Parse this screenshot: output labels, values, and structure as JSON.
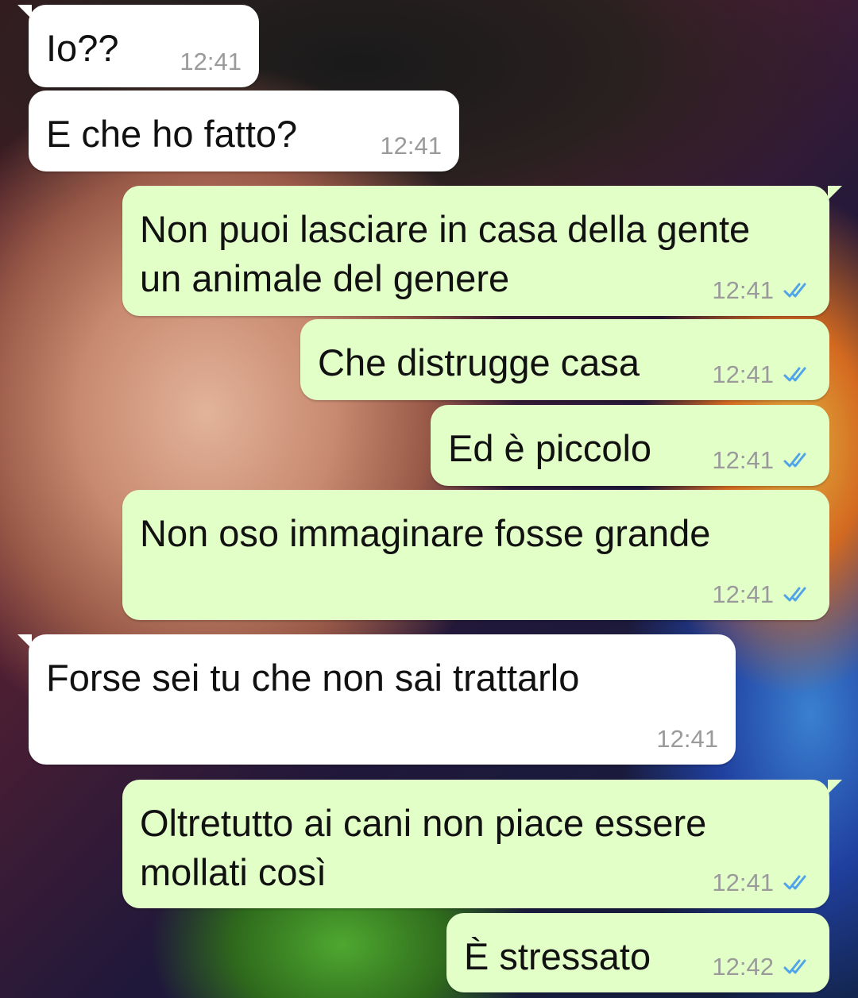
{
  "messages": [
    {
      "direction": "incoming",
      "text": "Io??",
      "time": "12:41"
    },
    {
      "direction": "incoming",
      "text": "E che ho fatto?",
      "time": "12:41"
    },
    {
      "direction": "outgoing",
      "text": "Non puoi lasciare in casa della gente\nun animale del genere",
      "time": "12:41",
      "status": "read-double-check-icon"
    },
    {
      "direction": "outgoing",
      "text": "Che distrugge casa",
      "time": "12:41",
      "status": "read-double-check-icon"
    },
    {
      "direction": "outgoing",
      "text": "Ed è piccolo",
      "time": "12:41",
      "status": "read-double-check-icon"
    },
    {
      "direction": "outgoing",
      "text": "Non oso immaginare fosse grande",
      "time": "12:41",
      "status": "read-double-check-icon"
    },
    {
      "direction": "incoming",
      "text": "Forse sei tu che non sai trattarlo",
      "time": "12:41"
    },
    {
      "direction": "outgoing",
      "text": "Oltretutto ai cani non piace essere\nmollati così",
      "time": "12:41",
      "status": "read-double-check-icon"
    },
    {
      "direction": "outgoing",
      "text": "È stressato",
      "time": "12:42",
      "status": "read-double-check-icon"
    }
  ],
  "colors": {
    "incoming_bubble": "#ffffff",
    "outgoing_bubble": "#e2ffc8",
    "time_text": "#9a9a9a",
    "read_ticks": "#4fa3e8"
  }
}
